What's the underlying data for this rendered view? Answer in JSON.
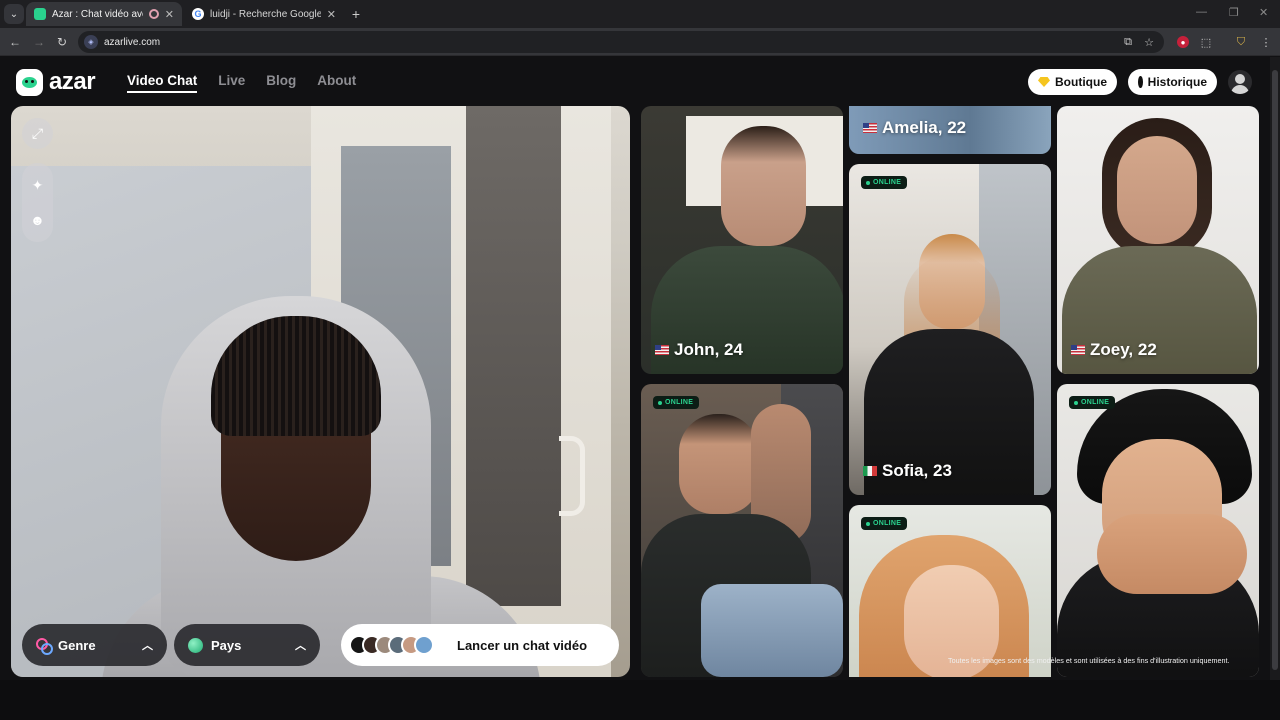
{
  "browser": {
    "tabs": [
      {
        "title": "Azar : Chat vidéo avec de n",
        "active": true
      },
      {
        "title": "luidji - Recherche Google",
        "active": false
      }
    ],
    "url": "azarlive.com",
    "icons": {
      "tab_menu": "chevron-down-icon",
      "close": "close-icon",
      "new_tab": "plus-icon",
      "back": "arrow-left-icon",
      "forward": "arrow-right-icon",
      "reload": "reload-icon"
    }
  },
  "header": {
    "logo": "azar",
    "nav": [
      {
        "label": "Video Chat",
        "active": true
      },
      {
        "label": "Live",
        "active": false
      },
      {
        "label": "Blog",
        "active": false
      },
      {
        "label": "About",
        "active": false
      }
    ],
    "shop_label": "Boutique",
    "history_label": "Historique"
  },
  "controls": {
    "gender_label": "Genre",
    "country_label": "Pays",
    "launch_label": "Lancer un chat vidéo"
  },
  "cards": [
    {
      "name": "John, 24",
      "flag": "us",
      "online": false
    },
    {
      "name": "Amelia, 22",
      "flag": "us",
      "online": false
    },
    {
      "name": "Sofia, 23",
      "flag": "it",
      "online": true
    },
    {
      "name": "Zoey, 22",
      "flag": "us",
      "online": false
    },
    {
      "name": "",
      "flag": "",
      "online": true
    },
    {
      "name": "",
      "flag": "",
      "online": true
    },
    {
      "name": "",
      "flag": "",
      "online": true
    }
  ],
  "online_label": "ONLINE",
  "disclaimer": "Toutes les images sont des modèles et sont utilisées à des fins d'illustration uniquement.",
  "colors": {
    "accent": "#2ad28e",
    "background": "#111113",
    "nav_inactive": "#8e8e93",
    "gem": "#f5c51f"
  }
}
